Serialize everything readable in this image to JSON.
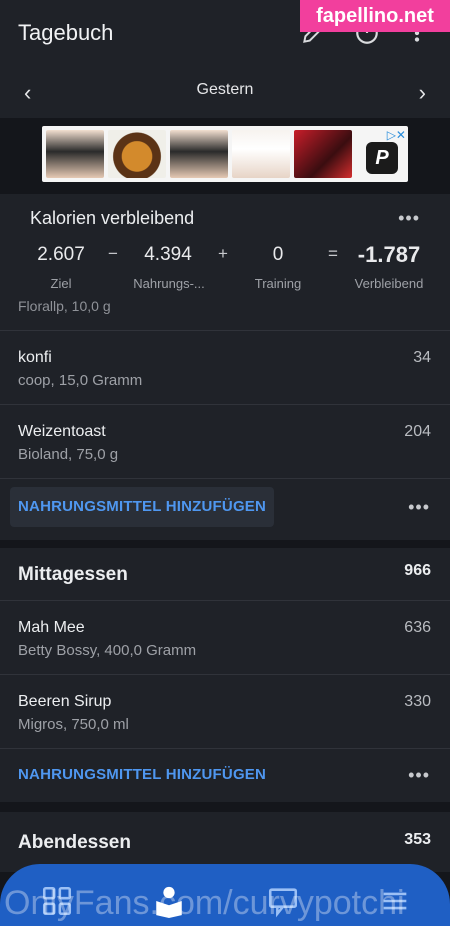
{
  "header": {
    "title": "Tagebuch",
    "date_label": "Gestern"
  },
  "watermark_tag": "fapellino.net",
  "ad": {
    "adchoices": "▷✕",
    "logo_letter": "P"
  },
  "calories": {
    "title": "Kalorien verbleibend",
    "goal_value": "2.607",
    "goal_label": "Ziel",
    "food_value": "4.394",
    "food_label": "Nahrungs-...",
    "exercise_value": "0",
    "exercise_label": "Training",
    "remaining_value": "-1.787",
    "remaining_label": "Verbleibend",
    "op_minus": "−",
    "op_plus": "+",
    "op_equals": "="
  },
  "partial_row": "Florallp, 10,0 g",
  "breakfast_items": [
    {
      "name": "konfi",
      "sub": "coop, 15,0 Gramm",
      "cal": "34"
    },
    {
      "name": "Weizentoast",
      "sub": "Bioland, 75,0 g",
      "cal": "204"
    }
  ],
  "add_food_label": "NAHRUNGSMITTEL HINZUFÜGEN",
  "lunch": {
    "title": "Mittagessen",
    "total": "966",
    "items": [
      {
        "name": "Mah Mee",
        "sub": "Betty Bossy, 400,0 Gramm",
        "cal": "636"
      },
      {
        "name": "Beeren Sirup",
        "sub": "Migros, 750,0 ml",
        "cal": "330"
      }
    ]
  },
  "dinner": {
    "title": "Abendessen",
    "total": "353"
  },
  "bottom_watermark": "OnlyFans.com/curvypotchi",
  "colors": {
    "accent": "#4f97f0",
    "nav": "#1f5fc4",
    "tag": "#f23f9d"
  }
}
